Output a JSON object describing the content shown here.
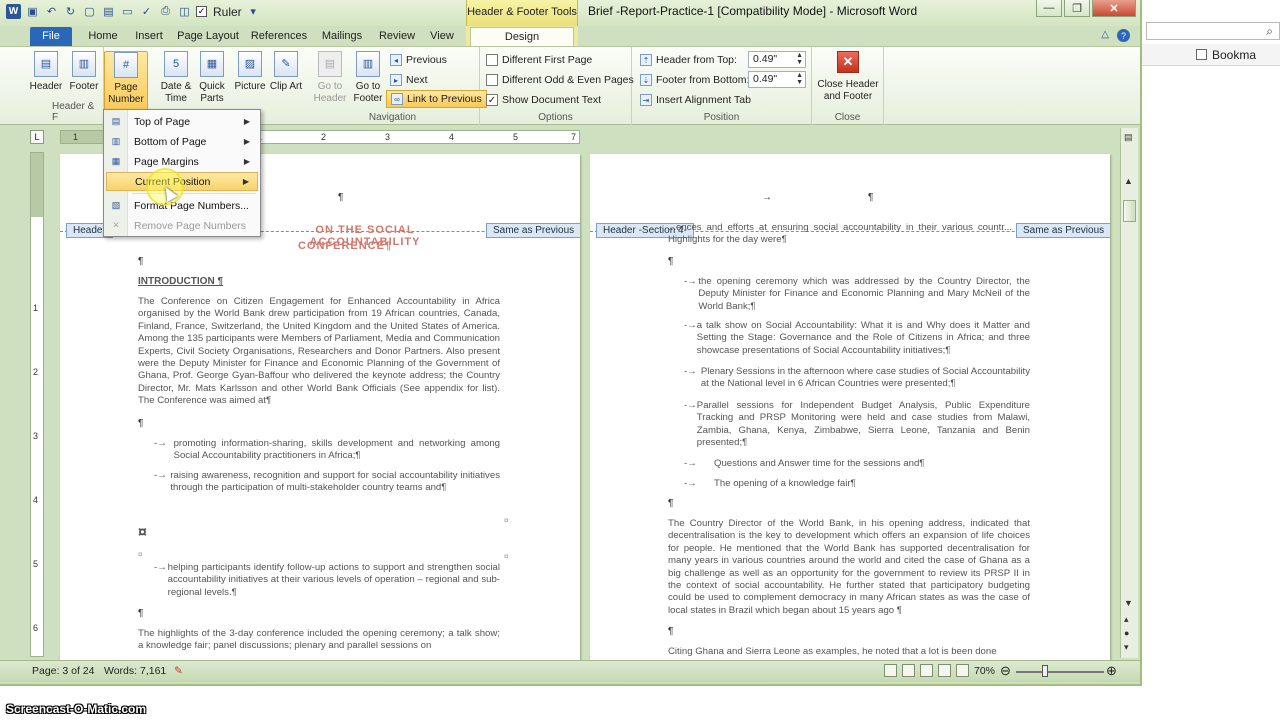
{
  "browser": {
    "bookmarks_label": "Bookma"
  },
  "qat": {
    "ruler_label": "Ruler"
  },
  "window": {
    "context_tools_label": "Header & Footer Tools",
    "title": "Brief -Report-Practice-1 [Compatibility Mode]  -  Microsoft Word"
  },
  "tabs": [
    "File",
    "Home",
    "Insert",
    "Page Layout",
    "References",
    "Mailings",
    "Review",
    "View",
    "Design"
  ],
  "ribbon": {
    "header_label": "Header",
    "footer_label": "Footer",
    "page_number_label": "Page Number",
    "date_time_label": "Date & Time",
    "quick_parts_label": "Quick Parts",
    "picture_label": "Picture",
    "clip_art_label": "Clip Art",
    "group_header_footer": "Header & F",
    "go_to_header_label": "Go to Header",
    "go_to_footer_label": "Go to Footer",
    "previous_label": "Previous",
    "next_label": "Next",
    "link_previous_label": "Link to Previous",
    "group_navigation": "Navigation",
    "diff_first_label": "Different First Page",
    "diff_oddeven_label": "Different Odd & Even Pages",
    "show_doc_text_label": "Show Document Text",
    "group_options": "Options",
    "header_from_top_label": "Header from Top:",
    "header_from_top_value": "0.49\"",
    "footer_from_bottom_label": "Footer from Bottom:",
    "footer_from_bottom_value": "0.49\"",
    "insert_alignment_tab_label": "Insert Alignment Tab",
    "group_position": "Position",
    "close_label": "Close Header and Footer",
    "group_close": "Close"
  },
  "dropdown": {
    "items": [
      {
        "label": "Top of Page",
        "submenu": true
      },
      {
        "label": "Bottom of Page",
        "submenu": true
      },
      {
        "label": "Page Margins",
        "submenu": true
      },
      {
        "label": "Current Position",
        "submenu": true
      },
      {
        "label": "Format Page Numbers...",
        "submenu": false
      },
      {
        "label": "Remove Page Numbers",
        "submenu": false
      }
    ]
  },
  "ruler": {
    "ticks": [
      "1",
      "1",
      "2",
      "3",
      "4",
      "5",
      "6",
      "7"
    ]
  },
  "left_page": {
    "header_tag": "Header",
    "same_as_previous": "Same as Previous",
    "title_line1": "ON THE SOCIAL ACCOUNTABILITY",
    "title_line2": "CONFERENCE¶",
    "intro_heading": "INTRODUCTION ¶",
    "para1": "The Conference on Citizen Engagement for Enhanced Accountability in Africa organised by the World Bank drew participation from 19 African countries, Canada, Finland, France, Switzerland, the United Kingdom and the United States of America. Among the 135 participants were Members of Parliament, Media and Communication Experts, Civil Society Organisations, Researchers and Donor Partners. Also present were the Deputy Minister for Finance and Economic Planning of the Government of Ghana, Prof. George Gyan-Baffour who delivered the keynote address; the Country Director, Mr. Mats Karlsson and other World Bank Officials (See appendix for list). The Conference was aimed at¶",
    "bullet1": "promoting information-sharing, skills development and networking among Social Accountability practitioners in Africa;¶",
    "bullet2": "raising awareness, recognition and support for social accountability initiatives through the participation of multi-stakeholder country teams and¶",
    "bullet3": "helping participants identify follow-up actions to support and strengthen social accountability initiatives at their various levels of operation – regional and sub-regional levels.¶",
    "para2": "The highlights of the 3-day conference included the opening ceremony; a talk show; a knowledge fair; panel discussions; plenary and parallel sessions on"
  },
  "right_page": {
    "header_tag": "Header -Section 4-",
    "same_as_previous": "Same as Previous",
    "top_text": "...ences and efforts at ensuring social accountability in their various countr... Highlights for the day were¶",
    "bullet1": "the opening ceremony which was addressed by the Country Director, the Deputy Minister for Finance and Economic Planning and Mary McNeil of the World Bank;¶",
    "bullet2": "a talk show on Social Accountability: What it is and Why does it Matter and Setting the Stage: Governance and the Role of Citizens in Africa; and three showcase presentations of Social Accountability initiatives;¶",
    "bullet3": "Plenary Sessions in the afternoon where case studies of Social Accountability at the National level in 6 African Countries were presented;¶",
    "bullet4": "Parallel sessions for Independent Budget Analysis, Public Expenditure Tracking and PRSP Monitoring were held and case studies from Malawi, Zambia, Ghana, Kenya, Zimbabwe, Sierra Leone, Tanzania and Benin presented;¶",
    "bullet5": "Questions and Answer time for the sessions and¶",
    "bullet6": "The opening of a knowledge fair¶",
    "para1": "The Country Director of the World Bank, in his opening address, indicated that decentralisation is the key to development which offers an expansion of life choices for people. He mentioned that the World Bank has supported decentralisation for many years in various countries around the world and cited the case of Ghana as a big challenge as well as an opportunity for the government to review its PRSP II in the context of social accountability. He further stated that participatory budgeting could be used to complement democracy in many African states as was the case of local states in Brazil which began about 15 years ago ¶",
    "para2": "Citing Ghana and Sierra Leone as examples, he noted that a lot is been done"
  },
  "status": {
    "page": "Page: 3 of 24",
    "words": "Words: 7,161",
    "zoom": "70%"
  },
  "watermark": "Screencast-O-Matic.com"
}
